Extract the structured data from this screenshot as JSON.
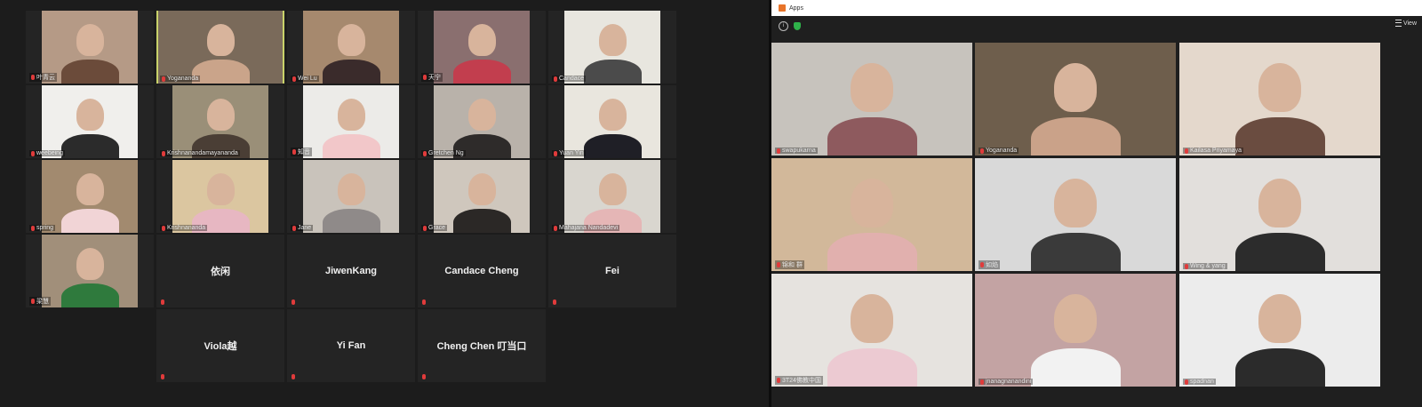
{
  "left_gallery": {
    "tiles": [
      {
        "name": "叶青云",
        "bg": "#b59a86",
        "person": "#6b4b3a"
      },
      {
        "name": "Yogananda",
        "bg": "#7a6a5a",
        "person": "#caa48a",
        "active": true
      },
      {
        "name": "Wei Lu",
        "bg": "#a6896e",
        "person": "#3a2b2b"
      },
      {
        "name": "天宁",
        "bg": "#8a6f6f",
        "person": "#c23e4e"
      },
      {
        "name": "Candace",
        "bg": "#e8e6df",
        "person": "#4b4b4b"
      },
      {
        "name": "weebeing",
        "bg": "#f0efec",
        "person": "#2b2b2b"
      },
      {
        "name": "Krishnanandamayananda",
        "bg": "#9a8f78",
        "person": "#4a3e35"
      },
      {
        "name": "知音",
        "bg": "#ecebe8",
        "person": "#f2c7c9"
      },
      {
        "name": "Gretchen Ng",
        "bg": "#b9b2aa",
        "person": "#2e2b2a"
      },
      {
        "name": "Yuan Yin",
        "bg": "#e9e6de",
        "person": "#1f1f26"
      },
      {
        "name": "spring",
        "bg": "#a28a6f",
        "person": "#f1d4d6"
      },
      {
        "name": "Krishnananda",
        "bg": "#dbc6a0",
        "person": "#e7b7c2"
      },
      {
        "name": "Jane",
        "bg": "#c9c3bb",
        "person": "#8f8a89"
      },
      {
        "name": "Grace",
        "bg": "#cfc7bd",
        "person": "#2b2826"
      },
      {
        "name": "Mahajana Nandadevi",
        "bg": "#d9d6cf",
        "person": "#e5b6b6"
      },
      {
        "name": "梁慧",
        "bg": "#a18f7a",
        "person": "#2f7a3d"
      }
    ],
    "name_only_tiles": [
      "依闲",
      "JiwenKang",
      "Candace Cheng",
      "Fei",
      "Viola越",
      "Yi Fan",
      "Cheng  Chen 叮当口"
    ]
  },
  "right_window": {
    "title": "Apps",
    "view_label": "View",
    "tiles": [
      {
        "name": "swapukarna",
        "bg": "#c7c3bd",
        "person": "#8e5a5e"
      },
      {
        "name": "Yogananda",
        "bg": "#6e5e4c",
        "person": "#caa289",
        "active": true
      },
      {
        "name": "Kailasa Priyamaya",
        "bg": "#e4d8cc",
        "person": "#6a4c40"
      },
      {
        "name": "锦和 群",
        "bg": "#d2b89a",
        "person": "#e1b0ae"
      },
      {
        "name": "如焰",
        "bg": "#d9d9d9",
        "person": "#3a3a3a"
      },
      {
        "name": "Wing & yang",
        "bg": "#e2dfdc",
        "person": "#2c2c2c"
      },
      {
        "name": "3T24佛教中国",
        "bg": "#e6e3df",
        "person": "#eccad2"
      },
      {
        "name": "jnanagnanandini",
        "bg": "#c3a3a3",
        "person": "#f2f2f2"
      },
      {
        "name": "spadnan",
        "bg": "#ececec",
        "person": "#2b2b2b"
      }
    ]
  }
}
